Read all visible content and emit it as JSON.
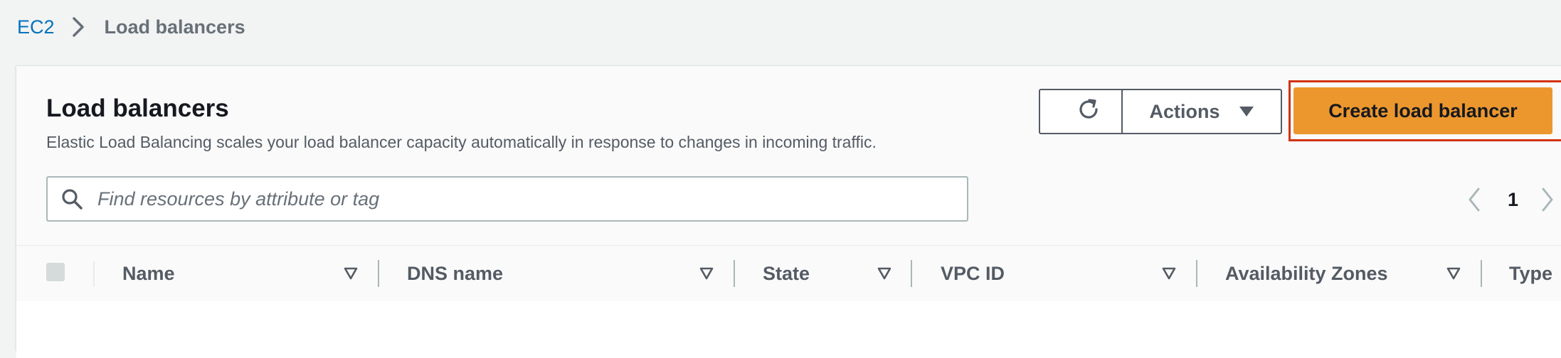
{
  "breadcrumb": {
    "parent": "EC2",
    "current": "Load balancers"
  },
  "panel": {
    "title": "Load balancers",
    "description": "Elastic Load Balancing scales your load balancer capacity automatically in response to changes in incoming traffic."
  },
  "toolbar": {
    "refresh_icon": "refresh-icon",
    "actions_label": "Actions",
    "create_label": "Create load balancer"
  },
  "search": {
    "placeholder": "Find resources by attribute or tag",
    "value": ""
  },
  "pagination": {
    "current_page": "1"
  },
  "table": {
    "columns": [
      {
        "label": "Name"
      },
      {
        "label": "DNS name"
      },
      {
        "label": "State"
      },
      {
        "label": "VPC ID"
      },
      {
        "label": "Availability Zones"
      },
      {
        "label": "Type"
      }
    ],
    "rows": []
  },
  "colors": {
    "primary_button": "#ec972d",
    "highlight_border": "#d13212",
    "link": "#0073bb"
  }
}
